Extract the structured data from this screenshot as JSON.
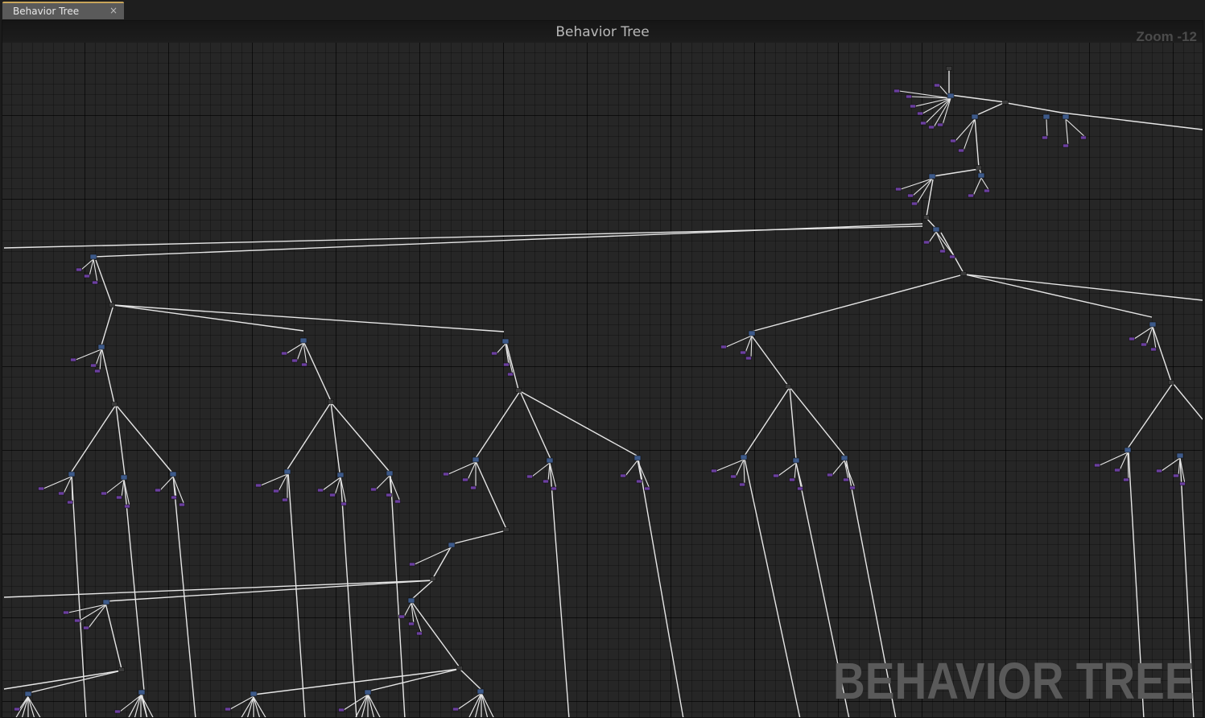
{
  "tab": {
    "label": "Behavior Tree",
    "close_glyph": "×",
    "close_icon": "close-icon"
  },
  "graph": {
    "title": "Behavior Tree",
    "zoom": "Zoom -12",
    "watermark": "BEHAVIOR TREE"
  },
  "colors": {
    "wire": "#e6e6e6",
    "composite_node": "#3a3a3a",
    "task_node": "#3d5a8a",
    "decorator_node": "#6b3fa0"
  }
}
